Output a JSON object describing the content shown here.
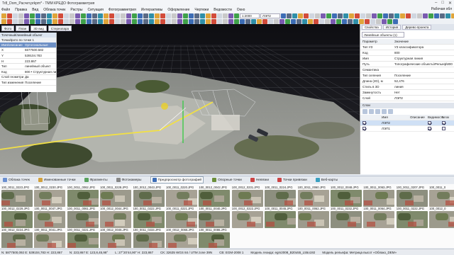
{
  "app": {
    "title": "Tr8_Dom_Расчет.prkpm* - TMM КРЕДО Фотограмметрия",
    "workspace": "Рабочая обл"
  },
  "menu": [
    "Файл",
    "Правка",
    "Вид",
    "Облака точек",
    "Растры",
    "Ситуация",
    "Фотограмметрия",
    "Интерактивы",
    "Оформление",
    "Чертежи",
    "Ведомости",
    "Окно"
  ],
  "toolbar": {
    "scale": "1:2000",
    "layer": "ЛЭП2"
  },
  "left_panel": {
    "tabs": [
      "Фото",
      "План",
      "3D вид",
      "Стереопара"
    ],
    "title": "Точечный/линейный объект",
    "subtitle": "Точки/фото по точке 1",
    "header": [
      "Имя/описание координат",
      "Ортогональные"
    ],
    "rows": [
      [
        "X",
        "6677500.582"
      ],
      [
        "Y",
        "539104.783"
      ],
      [
        "H",
        "223.867"
      ],
      [
        "Тип",
        "линейный объект"
      ],
      [
        "Код",
        "800 • Структурная линия"
      ],
      [
        "Слой геометрии",
        "Да"
      ],
      [
        "Тип изменения",
        "Поселение"
      ]
    ]
  },
  "viewport_tabs": [
    "Фото",
    "План",
    "3D вид",
    "Стереопара"
  ],
  "right_panel": {
    "tabs": [
      "Свойства",
      "История",
      "Дерево проекта"
    ],
    "object_type": "Линейные объекты (1)",
    "props": [
      [
        "Параметр",
        "Значение"
      ],
      [
        "Тип УЗ",
        "УЗ классификатора"
      ],
      [
        "Код",
        "800"
      ],
      [
        "Имя",
        "Структурная линия"
      ],
      [
        "Путь",
        "Топографические объекты\\Рельеф\\800"
      ],
      [
        "Семантика",
        ""
      ],
      [
        "Тип селения",
        "Поселение"
      ],
      [
        "Длина (2D), м",
        "52,476"
      ],
      [
        "Стиль в 3D",
        "линия"
      ],
      [
        "Замкнутость",
        "Нет"
      ],
      [
        "Слой",
        "ЛЭП2"
      ]
    ],
    "layers_title": "Слои",
    "layers_header": [
      "Имя",
      "Описание",
      "Видимость",
      "Блок"
    ],
    "layers": [
      {
        "name": "ЛЭП2",
        "desc": "",
        "visible": true,
        "locked": true,
        "selected": true
      },
      {
        "name": "ЛЭП1",
        "desc": "",
        "visible": true,
        "locked": false,
        "selected": false
      }
    ]
  },
  "bottom_tabs": [
    "Облака точек",
    "Именованные точки",
    "Фрагменты",
    "Фотокамеры",
    "Предпросмотр фотографий",
    "Опорные точки",
    "Невязки",
    "Точки привязки",
    "Веб-карты"
  ],
  "bottom_tab_active": 4,
  "photos": [
    "100_0011_0223.JPG",
    "100_0012_0230.JPG",
    "100_0011_0062.JPG",
    "100_0011_0228.JPG",
    "100_0012_0043.JPG",
    "100_0011_0220.JPG",
    "100_0012_0042.JPG",
    "100_0012_0231.JPG",
    "100_0011_0224.JPG",
    "100_0011_0060.JPG",
    "100_0012_0048.JPG",
    "100_0011_0063.JPG",
    "100_0011_0207.JPG",
    "100_0011_0",
    "100_0012_0229.JPG",
    "100_0011_0047.JPG",
    "100_0011_0061.JPG",
    "100_0012_0044.JPG",
    "100_0011_0222.JPG",
    "100_0011_0221.JPG",
    "100_0011_0040.JPG",
    "100_0012_0222.JPG",
    "100_0011_0045.JPG",
    "100_0011_0062.JPG",
    "100_0011_0232.JPG",
    "100_0011_0064.JPG",
    "100_0011_0222.JPG",
    "100_0012_0",
    "100_0012_0224.JPG",
    "100_0011_0041.JPG",
    "100_0011_0221.JPG",
    "100_0012_0046.JPG",
    "100_0011_0233.JPG",
    "100_0012_0066.JPG",
    "100_0011_0086.JPG"
  ],
  "status": [
    "N: 5877500,092 E: 539104,783 H: 223,867",
    "N: 223,867 E: 123,8,45,98°",
    "L: 27°20'44,90\" H: 223,867",
    "СК: 32635 WGS 84 / UTM zone 39N",
    "СВ: EGM-2008 1",
    "Модель геоида: egm2008_B20o55_L55o192",
    "Модель рельефа: Метрица высот «Облако_DEM»"
  ],
  "colors": {
    "accent": "#3d6db5",
    "selection": "#cfe0f5",
    "polyline": "#f2e044",
    "highlight": "#3ec94a"
  }
}
